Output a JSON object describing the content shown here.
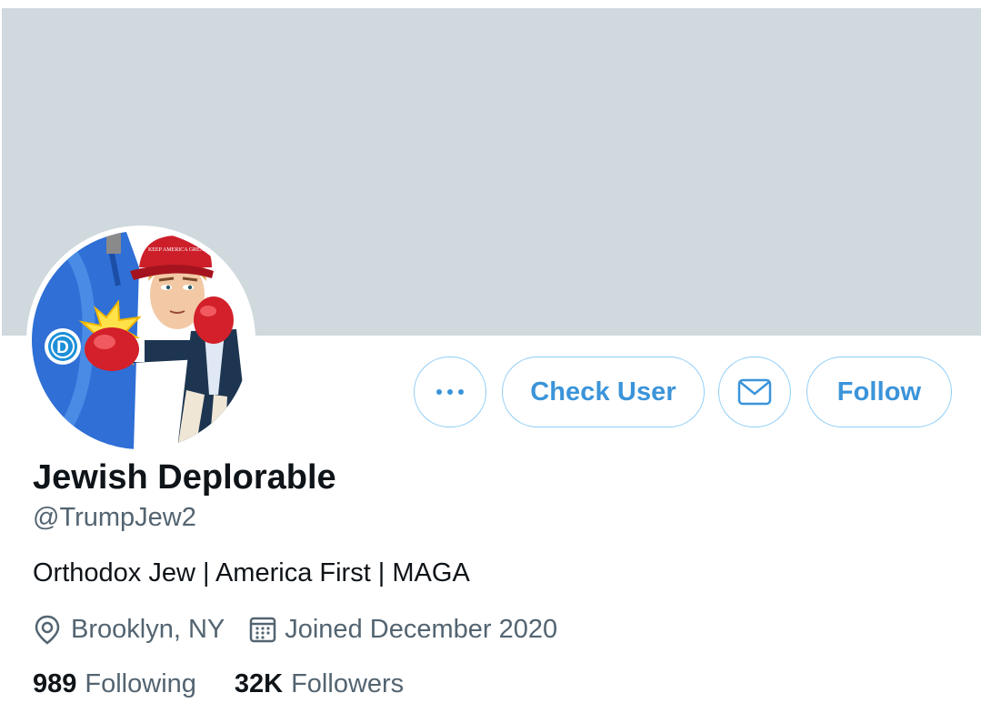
{
  "profile": {
    "name": "Jewish Deplorable",
    "handle": "@TrumpJew2",
    "bio": "Orthodox Jew | America First | MAGA",
    "location": "Brooklyn, NY",
    "joined": "Joined December 2020",
    "avatar_hat_text": "KEEP AMERICA GREAT",
    "avatar_badge_letter": "D"
  },
  "actions": {
    "more_icon": "more-horizontal-icon",
    "check_user_label": "Check User",
    "message_icon": "envelope-icon",
    "follow_label": "Follow"
  },
  "stats": {
    "following_count": "989",
    "following_label": "Following",
    "followers_count": "32K",
    "followers_label": "Followers"
  },
  "colors": {
    "banner": "#cfd9de",
    "accent": "#1d9bf0",
    "button_border": "#8ecdf8",
    "text_primary": "#0f1419",
    "text_secondary": "#536471"
  }
}
